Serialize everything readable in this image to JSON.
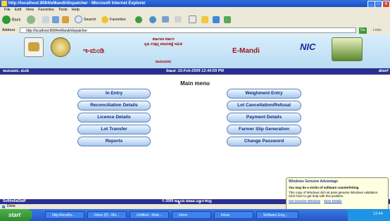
{
  "window": {
    "title": "http://localhost:8084/eMandi/dispatcher - Microsoft Internet Explorer",
    "min": "_",
    "max": "□",
    "close": "×"
  },
  "menu": [
    "File",
    "Edit",
    "View",
    "Favorites",
    "Tools",
    "Help"
  ],
  "toolbar": {
    "back": "Back",
    "search": "Search",
    "favorites": "Favorites"
  },
  "address": {
    "label": "Address",
    "url": "http://localhost:8084/eMandi/dispatcher",
    "go": "Go",
    "links": "Links"
  },
  "header": {
    "kannada_emandi": "ಇ-ಮಂಡಿ",
    "kannada_line1": "ಕರ್ನಾಟಕ ಸರ್ಕಾರ",
    "kannada_line2": "ಕೃಷಿ ಉತ್ಪನ್ನ ಮಾರುಕಟ್ಟೆ ಸಮಿತಿ",
    "kannada_line3": "ರಾಯಚೂರು",
    "emandi": "E-Mandi",
    "nic": "NIC"
  },
  "bluebar": {
    "left": "ರಾಯಚೂರು, ಮಂಡಿ",
    "center": "ದಿನಾಂಕ :15-Feb-2009 12:44:59 PM",
    "right": "ಹೊರಗೆ"
  },
  "main": {
    "title": "Main menu",
    "left_buttons": [
      "In Entry",
      "Reconciliation Details",
      "Licence Details",
      "Lot Transfer",
      "Reports"
    ],
    "right_buttons": [
      "Weighment Entry",
      "Lot Cancellation/Refusal",
      "Payment Details",
      "Farmer Slip Generation",
      "Change Password"
    ]
  },
  "footer": {
    "left": "SoftIndiaStaff",
    "center": "© 2009 ರಾಷ್ಟ್ರೀಯ ಮಾಹಿತಿ ವಿಜ್ಞಾನ ಕೇಂದ್ರ"
  },
  "status": {
    "text": "Done"
  },
  "balloon": {
    "title": "Windows Genuine Advantage",
    "heading": "You may be a victim of software counterfeiting",
    "body": "This copy of Windows did not pass genuine Windows validation. Click here to get help with this problem.",
    "link1": "Get Genuine Windows",
    "link2": "More Details"
  },
  "taskbar": {
    "start": "start",
    "tasks": [
      "http://localho...",
      "Inbox (0) - Mo...",
      "Untitled - Note...",
      "Inbox",
      "Inbox",
      "Software Eng..."
    ],
    "clock": "12:44"
  }
}
